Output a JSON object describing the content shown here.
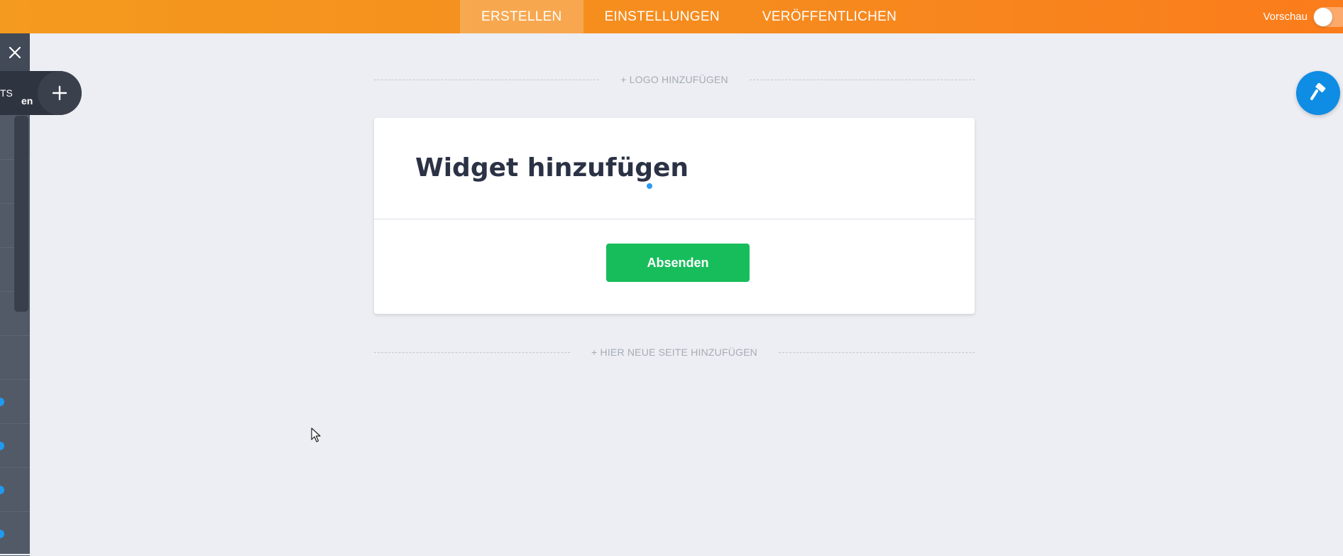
{
  "topbar": {
    "tabs": [
      {
        "label": "ERSTELLEN",
        "active": true
      },
      {
        "label": "EINSTELLUNGEN",
        "active": false
      },
      {
        "label": "VERÖFFENTLICHEN",
        "active": false
      }
    ],
    "preview_label": "Vorschau",
    "preview_on": false
  },
  "sidebar": {
    "close_icon": "close-icon",
    "elements_text": "TS",
    "elements_subtext": "en",
    "add_icon": "plus-icon"
  },
  "canvas": {
    "add_logo_label": "+ LOGO HINZUFÜGEN",
    "add_page_label": "+ HIER NEUE SEITE HINZUFÜGEN"
  },
  "form": {
    "title": "Widget hinzufügen",
    "submit_label": "Absenden"
  },
  "colors": {
    "accent_orange": "#f68a1e",
    "submit_green": "#18bd5b",
    "paint_blue": "#0f8ce4",
    "sidebar_dark": "#525a68"
  },
  "paint_button_icon": "paint-roller-icon"
}
